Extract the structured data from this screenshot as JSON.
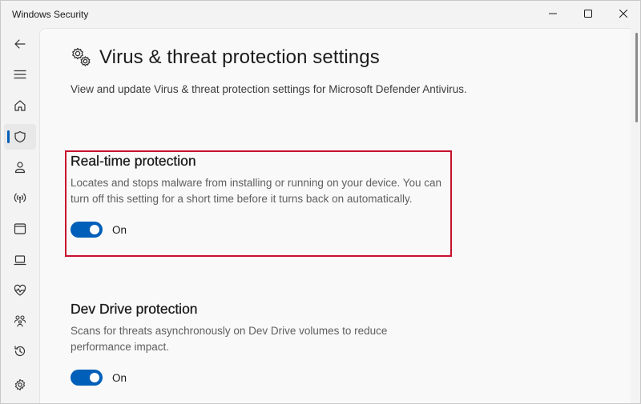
{
  "window": {
    "title": "Windows Security",
    "buttons": {
      "minimize": "minimize-icon",
      "maximize": "maximize-icon",
      "close": "close-icon"
    }
  },
  "nav": {
    "items": [
      {
        "name": "back",
        "icon": "back-arrow-icon"
      },
      {
        "name": "menu",
        "icon": "hamburger-icon"
      },
      {
        "name": "home",
        "icon": "home-icon"
      },
      {
        "name": "virus-threat-protection",
        "icon": "shield-icon",
        "selected": true
      },
      {
        "name": "account-protection",
        "icon": "person-icon"
      },
      {
        "name": "firewall-network",
        "icon": "wifi-antenna-icon"
      },
      {
        "name": "app-browser-control",
        "icon": "app-window-icon"
      },
      {
        "name": "device-security",
        "icon": "laptop-icon"
      },
      {
        "name": "device-performance-health",
        "icon": "heart-pulse-icon"
      },
      {
        "name": "family-options",
        "icon": "family-icon"
      },
      {
        "name": "protection-history",
        "icon": "history-icon"
      },
      {
        "name": "settings",
        "icon": "gear-icon"
      }
    ]
  },
  "page": {
    "title": "Virus & threat protection settings",
    "description": "View and update Virus & threat protection settings for Microsoft Defender Antivirus."
  },
  "sections": {
    "realtime": {
      "title": "Real-time protection",
      "description": "Locates and stops malware from installing or running on your device. You can turn off this setting for a short time before it turns back on automatically.",
      "toggle_state": "On",
      "enabled": true
    },
    "devdrive": {
      "title": "Dev Drive protection",
      "description": "Scans for threats asynchronously on Dev Drive volumes to reduce performance impact.",
      "toggle_state": "On",
      "enabled": true
    }
  },
  "colors": {
    "accent": "#005fb8",
    "highlight": "#c8102e",
    "content_bg": "#f9f9f9",
    "window_bg": "#f3f3f3"
  }
}
